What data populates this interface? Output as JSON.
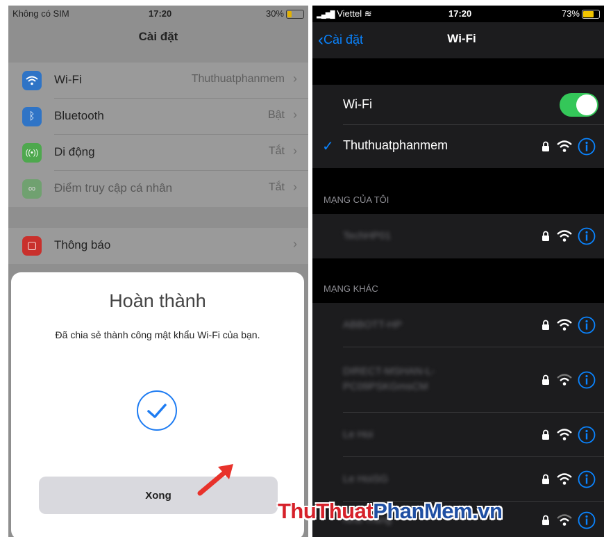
{
  "left_phone": {
    "status": {
      "carrier": "Không có SIM",
      "time": "17:20",
      "battery": "30%",
      "battery_level": 0.3
    },
    "nav_title": "Cài đặt",
    "rows": [
      {
        "label": "Wi-Fi",
        "value": "Thuthuatphanmem",
        "icon": "wifi-icon",
        "color": "#2f74c6"
      },
      {
        "label": "Bluetooth",
        "value": "Bật",
        "icon": "bluetooth-icon",
        "color": "#2f74c6"
      },
      {
        "label": "Di động",
        "value": "Tắt",
        "icon": "antenna-icon",
        "color": "#4ea84e"
      },
      {
        "label": "Điểm truy cập cá nhân",
        "value": "Tắt",
        "icon": "hotspot-icon",
        "color": "#4ea84e"
      }
    ],
    "row_notify": {
      "label": "Thông báo",
      "icon": "notification-icon",
      "color": "#c9302c"
    },
    "modal": {
      "title": "Hoàn thành",
      "message": "Đã chia sẻ thành công mật khẩu Wi-Fi của bạn.",
      "done_label": "Xong"
    }
  },
  "right_phone": {
    "status": {
      "carrier": "Viettel",
      "time": "17:20",
      "battery": "73%",
      "battery_level": 0.73
    },
    "back_label": "Cài đặt",
    "title": "Wi-Fi",
    "wifi_label": "Wi-Fi",
    "wifi_on": true,
    "connected": "Thuthuatphanmem",
    "my_networks_header": "MẠNG CỦA TÔI",
    "my_networks": [
      "TechHP01"
    ],
    "other_header": "MẠNG KHÁC",
    "other_networks": [
      [
        "ABBOTT-HP"
      ],
      [
        "DIRECT-MSHAN-L-",
        "PC09PSKGmsCM"
      ],
      [
        "Le Hoi"
      ],
      [
        "Le HoiSG"
      ],
      [
        "Nha Trang"
      ]
    ]
  },
  "watermark": {
    "part1": "ThuThuat",
    "part2": "PhanMem",
    "part3": ".vn",
    "color1": "#d6212a",
    "color2": "#1f4fa3"
  }
}
